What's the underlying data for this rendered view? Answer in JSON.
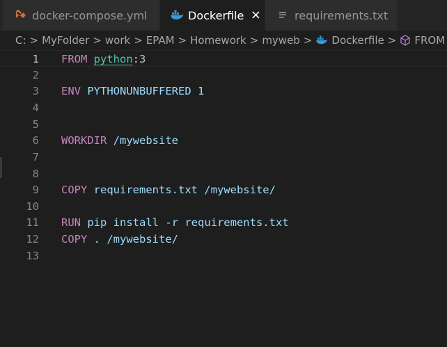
{
  "tabs": [
    {
      "label": "docker-compose.yml",
      "icon": "yaml-file-icon",
      "active": false
    },
    {
      "label": "Dockerfile",
      "icon": "docker-whale-icon",
      "active": true,
      "close": "×"
    },
    {
      "label": "requirements.txt",
      "icon": "text-file-icon",
      "active": false
    }
  ],
  "breadcrumb": {
    "items": [
      "C:",
      "MyFolder",
      "work",
      "EPAM",
      "Homework",
      "myweb",
      "Dockerfile",
      "FROM"
    ],
    "separator": ">"
  },
  "editor": {
    "line_numbers": [
      "1",
      "2",
      "3",
      "4",
      "5",
      "6",
      "7",
      "8",
      "9",
      "10",
      "11",
      "12",
      "13"
    ],
    "lines": {
      "l1": {
        "kw": "FROM",
        "image": "python",
        "colon": ":",
        "tag": "3"
      },
      "l3": {
        "kw": "ENV",
        "rest": "PYTHONUNBUFFERED 1"
      },
      "l6": {
        "kw": "WORKDIR",
        "rest": "/mywebsite"
      },
      "l9": {
        "kw": "COPY",
        "rest": "requirements.txt /mywebsite/"
      },
      "l11": {
        "kw": "RUN",
        "rest": "pip install -r requirements.txt"
      },
      "l12": {
        "kw": "COPY",
        "rest": ". /mywebsite/"
      }
    }
  },
  "colors": {
    "keyword": "#c586c0",
    "image": "#4ec9b0",
    "argument": "#9cdcfe",
    "number": "#b5cea8",
    "background": "#1e1e1e"
  }
}
